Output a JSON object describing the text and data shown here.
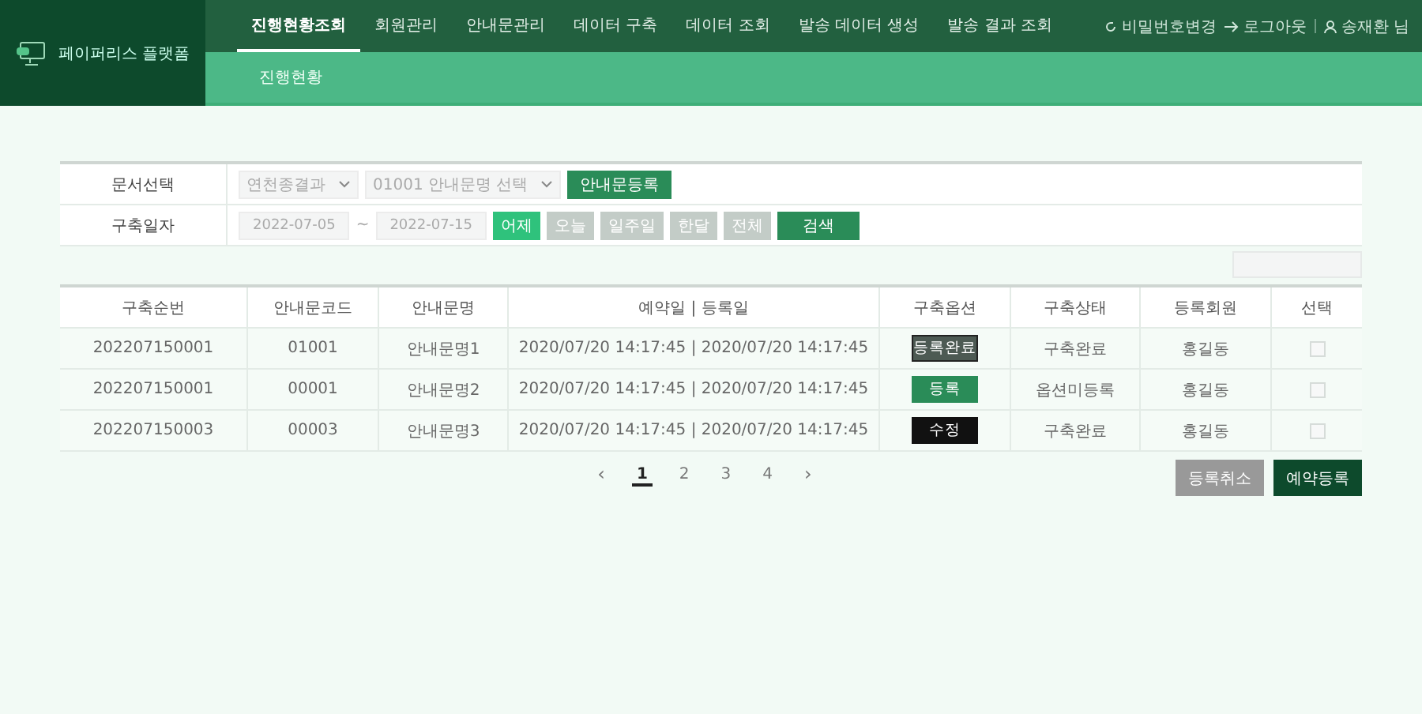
{
  "logo": {
    "title": "페이퍼리스 플랫폼"
  },
  "nav": [
    {
      "label": "진행현황조회",
      "selected": true
    },
    {
      "label": "회원관리",
      "selected": false
    },
    {
      "label": "안내문관리",
      "selected": false
    },
    {
      "label": "데이터 구축",
      "selected": false
    },
    {
      "label": "데이터 조회",
      "selected": false
    },
    {
      "label": "발송 데이터 생성",
      "selected": false
    },
    {
      "label": "발송 결과 조회",
      "selected": false
    }
  ],
  "user_menu": {
    "change_password": "비밀번호변경",
    "logout": "로그아웃",
    "user": "송재환 님"
  },
  "subnav": [
    "진행현황"
  ],
  "filter": {
    "doc_label": "문서선택",
    "select_1": "연천종결과",
    "select_2": "01001 안내문명 선택",
    "register_button": "안내문등록",
    "date_label": "구축일자",
    "date_from": "2022-07-05",
    "date_sep": "~",
    "date_to": "2022-07-15",
    "ranges": [
      {
        "label": "어제",
        "selected": true
      },
      {
        "label": "오늘",
        "selected": false
      },
      {
        "label": "일주일",
        "selected": false
      },
      {
        "label": "한달",
        "selected": false
      },
      {
        "label": "전체",
        "selected": false
      }
    ],
    "search_button": "검색"
  },
  "table": {
    "columns": [
      "구축순번",
      "안내문코드",
      "안내문명",
      "예약일 | 등록일",
      "구축옵션",
      "구축상태",
      "등록회원",
      "선택"
    ],
    "rows": [
      {
        "seq": "202207150001",
        "code": "01001",
        "name": "안내문명1",
        "dates": "2020/07/20 14:17:45 | 2020/07/20 14:17:45",
        "option": {
          "kind": "done",
          "label": "등록완료"
        },
        "status": "구축완료",
        "member": "홍길동",
        "checked": false
      },
      {
        "seq": "202207150001",
        "code": "00001",
        "name": "안내문명2",
        "dates": "2020/07/20 14:17:45 | 2020/07/20 14:17:45",
        "option": {
          "kind": "register",
          "label": "등록"
        },
        "status": "옵션미등록",
        "member": "홍길동",
        "checked": false
      },
      {
        "seq": "202207150003",
        "code": "00003",
        "name": "안내문명3",
        "dates": "2020/07/20 14:17:45 | 2020/07/20 14:17:45",
        "option": {
          "kind": "edit",
          "label": "수정"
        },
        "status": "구축완료",
        "member": "홍길동",
        "checked": false
      }
    ]
  },
  "pagination": {
    "prev": "‹",
    "next": "›",
    "pages": [
      {
        "label": "1",
        "selected": true
      },
      {
        "label": "2",
        "selected": false
      },
      {
        "label": "3",
        "selected": false
      },
      {
        "label": "4",
        "selected": false
      }
    ]
  },
  "actions": {
    "cancel": "등록취소",
    "reserve": "예약등록"
  }
}
